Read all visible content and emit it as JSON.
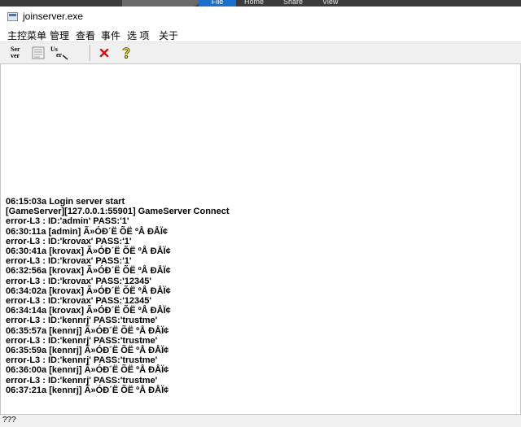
{
  "ribbon": {
    "tabs": [
      {
        "label": "File",
        "active": true
      },
      {
        "label": "Home",
        "active": false
      },
      {
        "label": "Share",
        "active": false
      },
      {
        "label": "View",
        "active": false
      }
    ],
    "accent_color": "#1a6fcf"
  },
  "window": {
    "title": "joinserver.exe",
    "icon": "app-window-icon"
  },
  "menu": {
    "items": [
      "主控菜单",
      "管理",
      "查看",
      "事件",
      "选 项",
      "关于"
    ]
  },
  "toolbar": {
    "buttons": [
      {
        "name": "server-button",
        "icon": "server-icon"
      },
      {
        "name": "log-button",
        "icon": "log-document-icon"
      },
      {
        "name": "users-button",
        "icon": "users-icon"
      },
      {
        "name": "close-button",
        "icon": "red-x-icon"
      },
      {
        "name": "help-button",
        "icon": "help-icon"
      }
    ],
    "server_icon_text": "Ser\nver",
    "users_icon_text": "Us\ner"
  },
  "log": {
    "lines": [
      "06:15:03a Login server start",
      "[GameServer][127.0.0.1:55901] GameServer Connect",
      "error-L3 : ID:'admin' PASS:'1'",
      "06:30:11a [admin] Ã»ÓÐ´Ë ÕË ºÅ ÐÅÏ¢",
      "error-L3 : ID:'krovax' PASS:'1'",
      "06:30:41a [krovax] Ã»ÓÐ´Ë ÕË ºÅ ÐÅÏ¢",
      "error-L3 : ID:'krovax' PASS:'1'",
      "06:32:56a [krovax] Ã»ÓÐ´Ë ÕË ºÅ ÐÅÏ¢",
      "error-L3 : ID:'krovax' PASS:'12345'",
      "06:34:02a [krovax] Ã»ÓÐ´Ë ÕË ºÅ ÐÅÏ¢",
      "error-L3 : ID:'krovax' PASS:'12345'",
      "06:34:14a [krovax] Ã»ÓÐ´Ë ÕË ºÅ ÐÅÏ¢",
      "error-L3 : ID:'kennrj' PASS:'trustme'",
      "06:35:57a [kennrj] Ã»ÓÐ´Ë ÕË ºÅ ÐÅÏ¢",
      "error-L3 : ID:'kennrj' PASS:'trustme'",
      "06:35:59a [kennrj] Ã»ÓÐ´Ë ÕË ºÅ ÐÅÏ¢",
      "error-L3 : ID:'kennrj' PASS:'trustme'",
      "06:36:00a [kennrj] Ã»ÓÐ´Ë ÕË ºÅ ÐÅÏ¢",
      "error-L3 : ID:'kennrj' PASS:'trustme'",
      "06:37:21a [kennrj] Ã»ÓÐ´Ë ÕË ºÅ ÐÅÏ¢"
    ]
  },
  "status": {
    "text": "???"
  }
}
